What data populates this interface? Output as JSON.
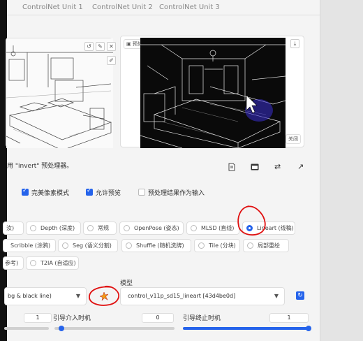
{
  "tabs": [
    "ControlNet Unit 1",
    "ControlNet Unit 2",
    "ControlNet Unit 3"
  ],
  "preview": {
    "title": "预处理结果预览",
    "close_label": "关闭"
  },
  "notice": "用 \"invert\" 预处理器。",
  "toolbar_icons": [
    "document-icon",
    "camera-icon",
    "swap-icon",
    "arrow-up-right-icon"
  ],
  "checkboxes": [
    {
      "label": "完美像素模式",
      "checked": true
    },
    {
      "label": "允许预览",
      "checked": true
    },
    {
      "label": "预处理结果作为输入",
      "checked": false
    }
  ],
  "control_types": {
    "row1": [
      {
        "label": "汝)",
        "selected": false
      },
      {
        "label": "Depth (深度)",
        "selected": false
      },
      {
        "label": "常规",
        "selected": false
      },
      {
        "label": "OpenPose (姿态)",
        "selected": false
      },
      {
        "label": "MLSD (直线)",
        "selected": false
      },
      {
        "label": "Lineart (线稿)",
        "selected": true
      }
    ],
    "row2": [
      {
        "label": "Scribble (涂鸦)",
        "selected": false
      },
      {
        "label": "Seg (语义分割)",
        "selected": false
      },
      {
        "label": "Shuffle (随机洗牌)",
        "selected": false
      },
      {
        "label": "Tile (分块)",
        "selected": false
      },
      {
        "label": "局部重绘",
        "selected": false
      }
    ],
    "row3": [
      {
        "label": "参考)",
        "selected": false
      },
      {
        "label": "T2IA (自适应)",
        "selected": false
      }
    ]
  },
  "preprocessor": {
    "value": "bg & black line)"
  },
  "model": {
    "label": "模型",
    "value": "control_v11p_sd15_lineart [43d4be0d]"
  },
  "sliders": {
    "start_value": "1",
    "start_label": "引导介入时机",
    "mid_value": "0",
    "end_label": "引导终止时机",
    "end_value": "1",
    "start_fraction": 0,
    "end_fraction": 1
  },
  "colors": {
    "accent": "#2563eb",
    "annotation": "#e01010"
  }
}
